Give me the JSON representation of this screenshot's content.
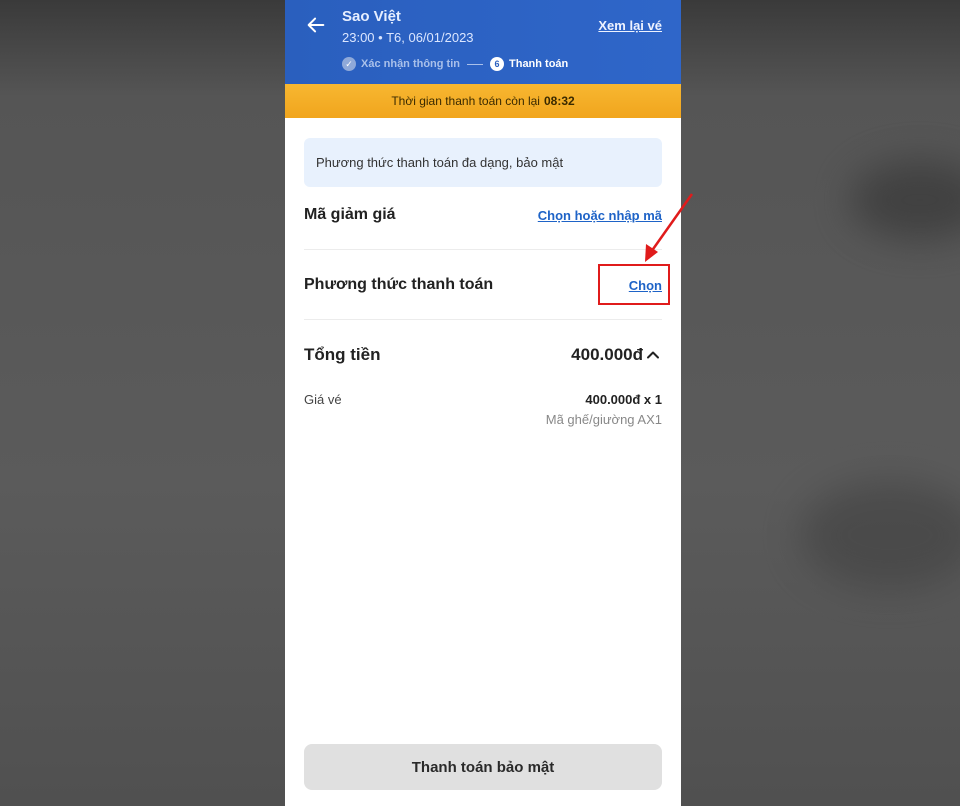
{
  "header": {
    "operator_name": "Sao Việt",
    "trip_time": "23:00 • T6, 06/01/2023",
    "review_ticket_link": "Xem lại vé",
    "steps": {
      "done_label": "Xác nhận thông tin",
      "current_number": "6",
      "current_label": "Thanh toán"
    }
  },
  "timer": {
    "label": "Thời gian thanh toán còn lại",
    "value": "08:32"
  },
  "info_box": {
    "text": "Phương thức thanh toán đa dạng, bảo mật"
  },
  "discount": {
    "label": "Mã giảm giá",
    "link": "Chọn hoặc nhập mã"
  },
  "payment_method": {
    "label": "Phương thức thanh toán",
    "link": "Chọn"
  },
  "total": {
    "label": "Tổng tiền",
    "amount": "400.000đ",
    "fare_label": "Giá vé",
    "fare_value": "400.000đ x 1",
    "seat_code": "Mã ghế/giường AX1"
  },
  "pay_button": {
    "label": "Thanh toán bảo mật"
  },
  "colors": {
    "header_blue": "#2a5fbe",
    "timer_orange": "#f4ad26",
    "link_blue": "#1e63c7",
    "highlight_red": "#e01b1b"
  },
  "icons": [
    "back-arrow-icon",
    "check-icon",
    "chevron-up-icon"
  ]
}
